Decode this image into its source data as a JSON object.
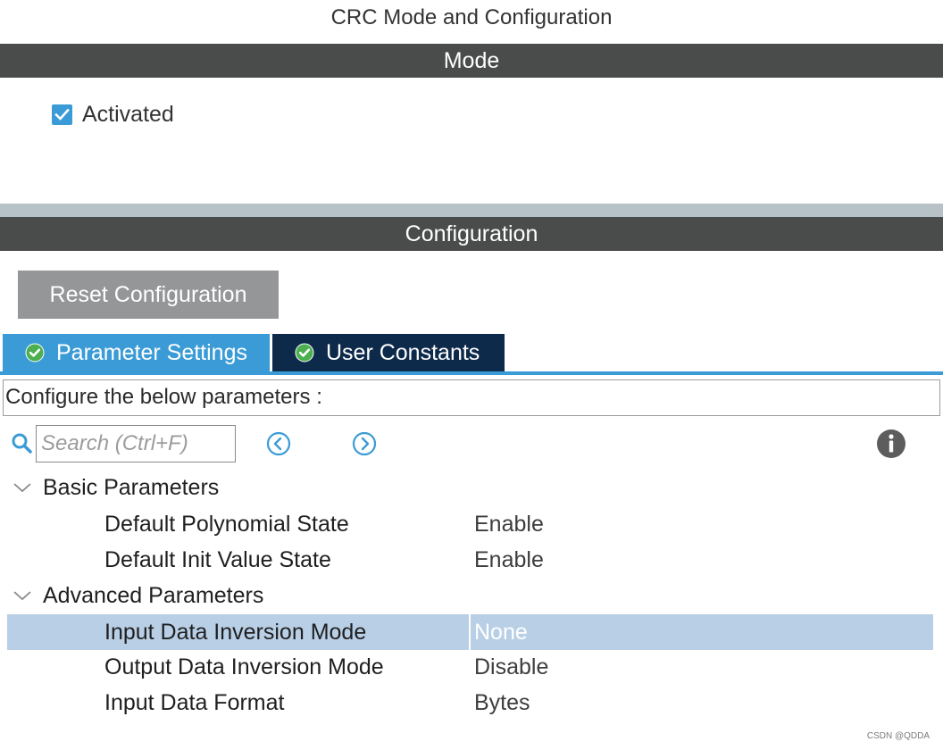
{
  "window": {
    "title": "CRC Mode and Configuration"
  },
  "mode": {
    "header": "Mode",
    "activated": {
      "label": "Activated",
      "checked": true
    }
  },
  "configuration": {
    "header": "Configuration",
    "reset_button": "Reset Configuration",
    "tabs": [
      {
        "label": "Parameter Settings",
        "active": true,
        "icon": "check-circle-icon"
      },
      {
        "label": "User Constants",
        "active": false,
        "icon": "check-circle-icon"
      }
    ],
    "description": "Configure the below parameters :",
    "search": {
      "placeholder": "Search (Ctrl+F)",
      "value": ""
    },
    "groups": [
      {
        "label": "Basic Parameters",
        "expanded": true,
        "params": [
          {
            "name": "Default Polynomial State",
            "value": "Enable",
            "selected": false
          },
          {
            "name": "Default Init Value State",
            "value": "Enable",
            "selected": false
          }
        ]
      },
      {
        "label": "Advanced Parameters",
        "expanded": true,
        "params": [
          {
            "name": "Input Data Inversion Mode",
            "value": "None",
            "selected": true
          },
          {
            "name": "Output Data Inversion Mode",
            "value": "Disable",
            "selected": false
          },
          {
            "name": "Input Data Format",
            "value": "Bytes",
            "selected": false
          }
        ]
      }
    ]
  },
  "watermark": "CSDN @QDDA",
  "colors": {
    "band": "#4a4c4c",
    "accent": "#3a9bd6",
    "tab_inactive": "#0d2a4a",
    "selected_row": "#b8cfe6",
    "tab_check": "#4caf50"
  }
}
